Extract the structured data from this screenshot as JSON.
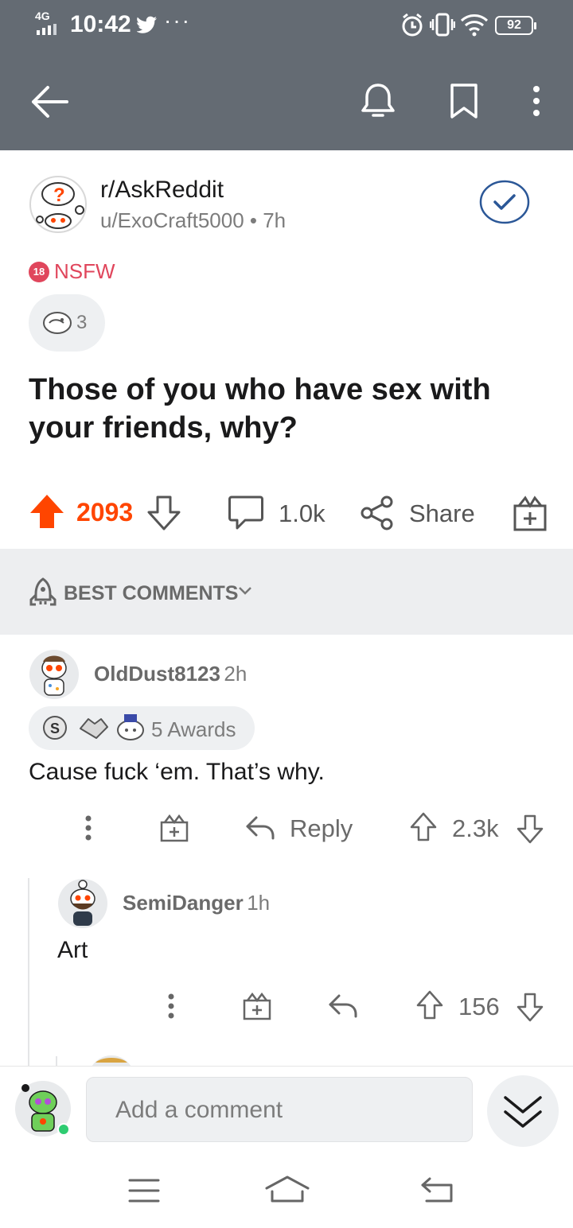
{
  "status_bar": {
    "network": "4G",
    "time": "10:42",
    "battery": "92",
    "icons": [
      "twitter-icon",
      "more-dots-icon",
      "alarm-icon",
      "vibrate-icon",
      "wifi-icon",
      "battery-icon"
    ]
  },
  "app_bar": {
    "icons": [
      "back-arrow-icon",
      "bell-icon",
      "bookmark-icon",
      "more-vertical-icon"
    ],
    "colors": {
      "background": "#646b73"
    }
  },
  "post": {
    "subreddit": "r/AskReddit",
    "author_meta": "u/ExoCraft5000 • 7h",
    "nsfw_badge": "18",
    "nsfw_label": "NSFW",
    "award_count": "3",
    "title": "Those of you who have sex with your friends, why?",
    "upvotes": "2093",
    "comments": "1.0k",
    "share_label": "Share",
    "colors": {
      "upvote": "#ff4500",
      "nsfw": "#e0465c",
      "join": "#2b5797"
    }
  },
  "sort": {
    "label": "BEST COMMENTS"
  },
  "comments": [
    {
      "author": "OldDust8123",
      "age": "2h",
      "awards_label": "5 Awards",
      "body": "Cause fuck ‘em. That’s why.",
      "reply_label": "Reply",
      "score": "2.3k"
    },
    {
      "author": "SemiDanger",
      "age": "1h",
      "body": "Art",
      "score": "156"
    }
  ],
  "composer": {
    "placeholder": "Add a comment"
  },
  "nav_bar": {
    "icons": [
      "menu-icon",
      "home-icon",
      "back-nav-icon"
    ]
  }
}
